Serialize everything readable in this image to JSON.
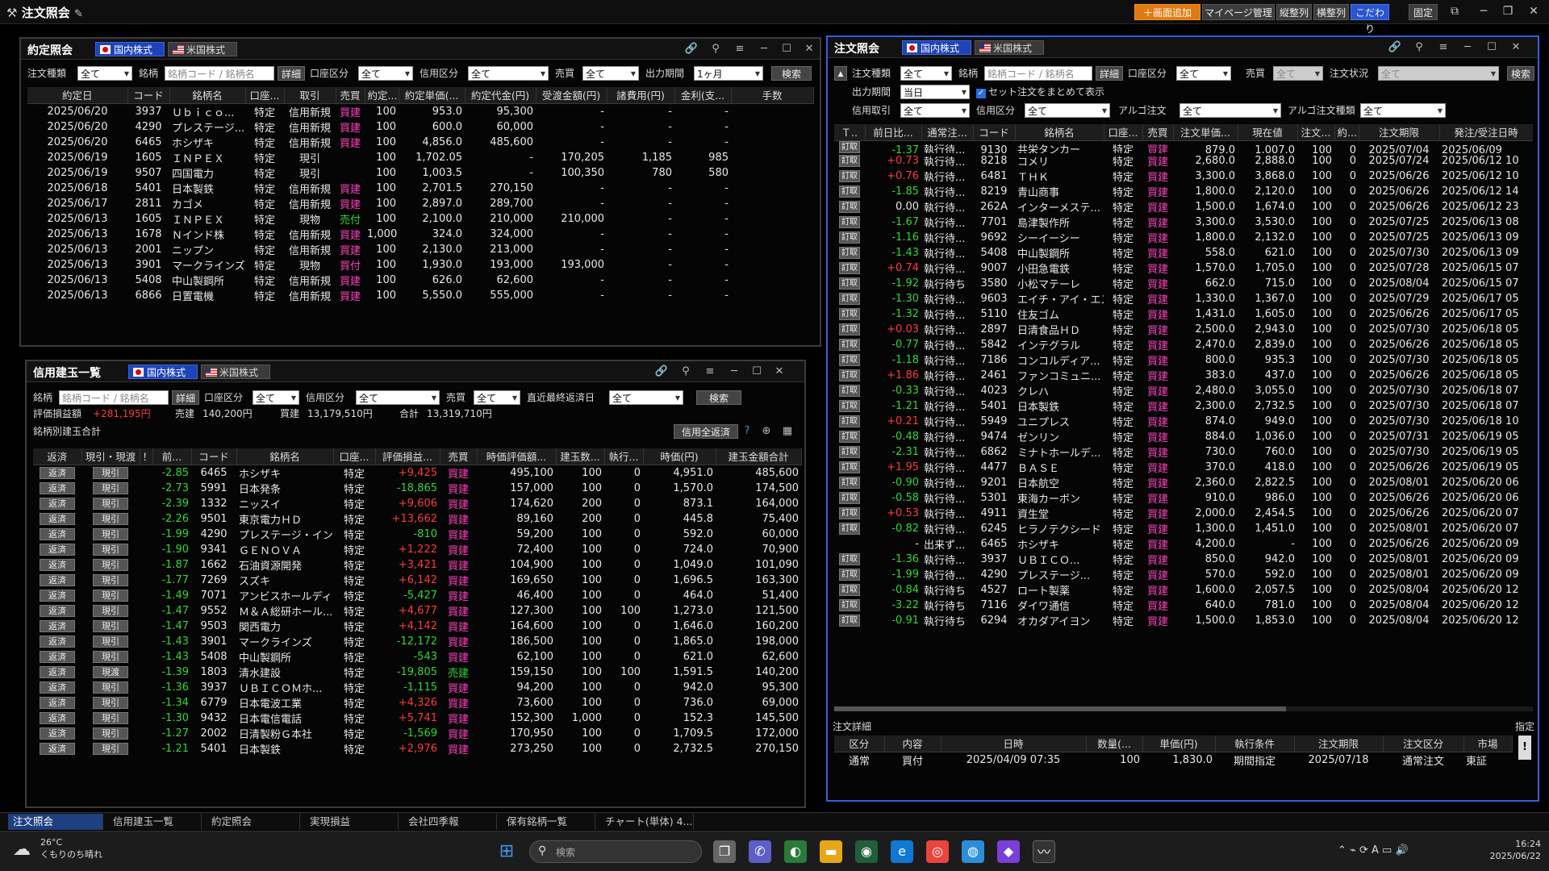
{
  "app": {
    "title": "注文照会",
    "buttons": [
      "＋画面追加",
      "マイページ管理",
      "縦整列",
      "横整列",
      "こだわり",
      "固定"
    ]
  },
  "tabs_market": {
    "domestic": "国内株式",
    "us": "米国株式"
  },
  "yakutei": {
    "title": "約定照会",
    "filters": {
      "order_type_label": "注文種類",
      "order_type": "全て",
      "stock_label": "銘柄",
      "stock_placeholder": "銘柄コード / 銘柄名",
      "detail": "詳細",
      "account_label": "口座区分",
      "account": "全て",
      "credit_label": "信用区分",
      "credit": "全て",
      "side_label": "売買",
      "side": "全て",
      "period_label": "出力期間",
      "period": "1ヶ月",
      "search": "検索"
    },
    "columns": [
      "約定日",
      "コード",
      "銘柄名",
      "口座...",
      "取引",
      "売買",
      "約定...",
      "約定単価(...",
      "約定代金(円)",
      "受渡金額(円)",
      "諸費用(円)",
      "金利(支...",
      "手数"
    ],
    "rows": [
      [
        "2025/06/20",
        "3937",
        "Ｕｂｉｃｏ...",
        "特定",
        "信用新規",
        "買建",
        "100",
        "953.0",
        "95,300",
        "-",
        "-",
        "-"
      ],
      [
        "2025/06/20",
        "4290",
        "プレステージ...",
        "特定",
        "信用新規",
        "買建",
        "100",
        "600.0",
        "60,000",
        "-",
        "-",
        "-"
      ],
      [
        "2025/06/20",
        "6465",
        "ホシザキ",
        "特定",
        "信用新規",
        "買建",
        "100",
        "4,856.0",
        "485,600",
        "-",
        "-",
        "-"
      ],
      [
        "2025/06/19",
        "1605",
        "ＩＮＰＥＸ",
        "特定",
        "現引",
        "",
        "100",
        "1,702.05",
        "-",
        "170,205",
        "1,185",
        "985"
      ],
      [
        "2025/06/19",
        "9507",
        "四国電力",
        "特定",
        "現引",
        "",
        "100",
        "1,003.5",
        "-",
        "100,350",
        "780",
        "580"
      ],
      [
        "2025/06/18",
        "5401",
        "日本製鉄",
        "特定",
        "信用新規",
        "買建",
        "100",
        "2,701.5",
        "270,150",
        "-",
        "-",
        "-"
      ],
      [
        "2025/06/17",
        "2811",
        "カゴメ",
        "特定",
        "信用新規",
        "買建",
        "100",
        "2,897.0",
        "289,700",
        "-",
        "-",
        "-"
      ],
      [
        "2025/06/13",
        "1605",
        "ＩＮＰＥＸ",
        "特定",
        "現物",
        "売付",
        "100",
        "2,100.0",
        "210,000",
        "210,000",
        "-",
        "-"
      ],
      [
        "2025/06/13",
        "1678",
        "Ｎインド株",
        "特定",
        "信用新規",
        "買建",
        "1,000",
        "324.0",
        "324,000",
        "-",
        "-",
        "-"
      ],
      [
        "2025/06/13",
        "2001",
        "ニップン",
        "特定",
        "信用新規",
        "買建",
        "100",
        "2,130.0",
        "213,000",
        "-",
        "-",
        "-"
      ],
      [
        "2025/06/13",
        "3901",
        "マークラインズ",
        "特定",
        "現物",
        "買付",
        "100",
        "1,930.0",
        "193,000",
        "193,000",
        "-",
        "-"
      ],
      [
        "2025/06/13",
        "5408",
        "中山製鋼所",
        "特定",
        "信用新規",
        "買建",
        "100",
        "626.0",
        "62,600",
        "-",
        "-",
        "-"
      ],
      [
        "2025/06/13",
        "6866",
        "日置電機",
        "特定",
        "信用新規",
        "買建",
        "100",
        "5,550.0",
        "555,000",
        "-",
        "-",
        "-"
      ]
    ]
  },
  "shinyo": {
    "title": "信用建玉一覧",
    "filters": {
      "stock_label": "銘柄",
      "stock_placeholder": "銘柄コード / 銘柄名",
      "detail": "詳細",
      "account_label": "口座区分",
      "account": "全て",
      "credit_label": "信用区分",
      "credit": "全て",
      "side_label": "売買",
      "side": "全て",
      "last_label": "直近最終返済日",
      "last": "全て",
      "search": "検索"
    },
    "summary": {
      "pl_label": "評価損益額",
      "pl": "+281,195円",
      "sell_label": "売建",
      "sell": "140,200円",
      "buy_label": "買建",
      "buy": "13,179,510円",
      "total_label": "合計",
      "total": "13,319,710円",
      "group_label": "銘柄別建玉合計",
      "bulk_button": "信用全返済"
    },
    "columns": [
      "返済",
      "現引・現渡",
      "！",
      "前...",
      "コード",
      "銘柄名",
      "口座...",
      "評価損益...",
      "売買",
      "時価評価額...",
      "建玉数...",
      "執行...",
      "時価(円)",
      "建玉金額合計"
    ],
    "rows": [
      [
        "返済",
        "現引",
        "-2.85",
        "6465",
        "ホシザキ",
        "特定",
        "+9,425",
        "買建",
        "495,100",
        "100",
        "0",
        "4,951.0",
        "485,600"
      ],
      [
        "返済",
        "現引",
        "-2.73",
        "5991",
        "日本発条",
        "特定",
        "-18,865",
        "買建",
        "157,000",
        "100",
        "0",
        "1,570.0",
        "174,500"
      ],
      [
        "返済",
        "現引",
        "-2.39",
        "1332",
        "ニッスイ",
        "特定",
        "+9,606",
        "買建",
        "174,620",
        "200",
        "0",
        "873.1",
        "164,000"
      ],
      [
        "返済",
        "現引",
        "-2.26",
        "9501",
        "東京電力ＨＤ",
        "特定",
        "+13,662",
        "買建",
        "89,160",
        "200",
        "0",
        "445.8",
        "75,400"
      ],
      [
        "返済",
        "現引",
        "-1.99",
        "4290",
        "プレステージ・インター",
        "特定",
        "-810",
        "買建",
        "59,200",
        "100",
        "0",
        "592.0",
        "60,000"
      ],
      [
        "返済",
        "現引",
        "-1.90",
        "9341",
        "ＧＥＮＯＶＡ",
        "特定",
        "+1,222",
        "買建",
        "72,400",
        "100",
        "0",
        "724.0",
        "70,900"
      ],
      [
        "返済",
        "現引",
        "-1.87",
        "1662",
        "石油資源開発",
        "特定",
        "+3,421",
        "買建",
        "104,900",
        "100",
        "0",
        "1,049.0",
        "101,090"
      ],
      [
        "返済",
        "現引",
        "-1.77",
        "7269",
        "スズキ",
        "特定",
        "+6,142",
        "買建",
        "169,650",
        "100",
        "0",
        "1,696.5",
        "163,300"
      ],
      [
        "返済",
        "現引",
        "-1.49",
        "7071",
        "アンビスホールディ...",
        "特定",
        "-5,427",
        "買建",
        "46,400",
        "100",
        "0",
        "464.0",
        "51,400"
      ],
      [
        "返済",
        "現引",
        "-1.47",
        "9552",
        "Ｍ＆Ａ総研ホール...",
        "特定",
        "+4,677",
        "買建",
        "127,300",
        "100",
        "100",
        "1,273.0",
        "121,500"
      ],
      [
        "返済",
        "現引",
        "-1.47",
        "9503",
        "関西電力",
        "特定",
        "+4,142",
        "買建",
        "164,600",
        "100",
        "0",
        "1,646.0",
        "160,200"
      ],
      [
        "返済",
        "現引",
        "-1.43",
        "3901",
        "マークラインズ",
        "特定",
        "-12,172",
        "買建",
        "186,500",
        "100",
        "0",
        "1,865.0",
        "198,000"
      ],
      [
        "返済",
        "現引",
        "-1.43",
        "5408",
        "中山製鋼所",
        "特定",
        "-543",
        "買建",
        "62,100",
        "100",
        "0",
        "621.0",
        "62,600"
      ],
      [
        "返済",
        "現渡",
        "-1.39",
        "1803",
        "清水建設",
        "特定",
        "-19,805",
        "売建",
        "159,150",
        "100",
        "100",
        "1,591.5",
        "140,200"
      ],
      [
        "返済",
        "現引",
        "-1.36",
        "3937",
        "ＵＢＩＣＯＭホ...",
        "特定",
        "-1,115",
        "買建",
        "94,200",
        "100",
        "0",
        "942.0",
        "95,300"
      ],
      [
        "返済",
        "現引",
        "-1.34",
        "6779",
        "日本電波工業",
        "特定",
        "+4,326",
        "買建",
        "73,600",
        "100",
        "0",
        "736.0",
        "69,000"
      ],
      [
        "返済",
        "現引",
        "-1.30",
        "9432",
        "日本電信電話",
        "特定",
        "+5,741",
        "買建",
        "152,300",
        "1,000",
        "0",
        "152.3",
        "145,500"
      ],
      [
        "返済",
        "現引",
        "-1.27",
        "2002",
        "日清製粉Ｇ本社",
        "特定",
        "-1,569",
        "買建",
        "170,950",
        "100",
        "0",
        "1,709.5",
        "172,000"
      ],
      [
        "返済",
        "現引",
        "-1.21",
        "5401",
        "日本製鉄",
        "特定",
        "+2,976",
        "買建",
        "273,250",
        "100",
        "0",
        "2,732.5",
        "270,150"
      ]
    ]
  },
  "chumon": {
    "title": "注文照会",
    "filters": {
      "order_type_label": "注文種類",
      "order_type": "全て",
      "stock_label": "銘柄",
      "stock_placeholder": "銘柄コード / 銘柄名",
      "detail": "詳細",
      "account_label": "口座区分",
      "account": "全て",
      "side_label": "売買",
      "side": "全て",
      "status_label": "注文状況",
      "status": "全て",
      "period_label": "出力期間",
      "period": "当日",
      "set_order_label": "セット注文をまとめて表示",
      "credit_label": "信用取引",
      "credit": "全て",
      "credit_class_label": "信用区分",
      "credit_class": "全て",
      "algo_label": "アルゴ注文",
      "algo": "全て",
      "algo_type_label": "アルゴ注文種類",
      "algo_type": "全て",
      "search": "検索"
    },
    "columns": [
      "Ｔ..",
      "前日比...",
      "通常注...",
      "コード",
      "銘柄名",
      "口座...",
      "売買",
      "注文単価...",
      "現在値",
      "注文...",
      "約...",
      "注文期限",
      "発注/受注日時"
    ],
    "partial_row": [
      "訂取",
      "-1.37",
      "執行待...",
      "9130",
      "共栄タンカー",
      "特定",
      "買建",
      "879.0",
      "1,007.0",
      "100",
      "0",
      "2025/07/04",
      "2025/06/09"
    ],
    "rows": [
      [
        "訂取",
        "+0.73",
        "執行待...",
        "8218",
        "コメリ",
        "特定",
        "買建",
        "2,680.0",
        "2,888.0",
        "100",
        "0",
        "2025/07/24",
        "2025/06/12 10"
      ],
      [
        "訂取",
        "+0.76",
        "執行待...",
        "6481",
        "ＴＨＫ",
        "特定",
        "買建",
        "3,300.0",
        "3,868.0",
        "100",
        "0",
        "2025/06/26",
        "2025/06/12 10"
      ],
      [
        "訂取",
        "-1.85",
        "執行待...",
        "8219",
        "青山商事",
        "特定",
        "買建",
        "1,800.0",
        "2,120.0",
        "100",
        "0",
        "2025/06/26",
        "2025/06/12 14"
      ],
      [
        "訂取",
        "0.00",
        "執行待...",
        "262A",
        "インターメステ...",
        "特定",
        "買建",
        "1,500.0",
        "1,674.0",
        "100",
        "0",
        "2025/06/26",
        "2025/06/12 23"
      ],
      [
        "訂取",
        "-1.67",
        "執行待...",
        "7701",
        "島津製作所",
        "特定",
        "買建",
        "3,300.0",
        "3,530.0",
        "100",
        "0",
        "2025/07/25",
        "2025/06/13 08"
      ],
      [
        "訂取",
        "-1.16",
        "執行待...",
        "9692",
        "シーイーシー",
        "特定",
        "買建",
        "1,800.0",
        "2,132.0",
        "100",
        "0",
        "2025/07/25",
        "2025/06/13 09"
      ],
      [
        "訂取",
        "-1.43",
        "執行待...",
        "5408",
        "中山製鋼所",
        "特定",
        "買建",
        "558.0",
        "621.0",
        "100",
        "0",
        "2025/07/30",
        "2025/06/13 09"
      ],
      [
        "訂取",
        "+0.74",
        "執行待...",
        "9007",
        "小田急電鉄",
        "特定",
        "買建",
        "1,570.0",
        "1,705.0",
        "100",
        "0",
        "2025/07/28",
        "2025/06/15 07"
      ],
      [
        "訂取",
        "-1.92",
        "執行待ち",
        "3580",
        "小松マテーレ",
        "特定",
        "買建",
        "662.0",
        "715.0",
        "100",
        "0",
        "2025/08/04",
        "2025/06/15 07"
      ],
      [
        "訂取",
        "-1.30",
        "執行待...",
        "9603",
        "エイチ・アイ・エス",
        "特定",
        "買建",
        "1,330.0",
        "1,367.0",
        "100",
        "0",
        "2025/07/29",
        "2025/06/17 05"
      ],
      [
        "訂取",
        "-1.32",
        "執行待...",
        "5110",
        "住友ゴム",
        "特定",
        "買建",
        "1,431.0",
        "1,605.0",
        "100",
        "0",
        "2025/06/26",
        "2025/06/17 05"
      ],
      [
        "訂取",
        "+0.03",
        "執行待...",
        "2897",
        "日清食品ＨＤ",
        "特定",
        "買建",
        "2,500.0",
        "2,943.0",
        "100",
        "0",
        "2025/07/30",
        "2025/06/18 05"
      ],
      [
        "訂取",
        "-0.77",
        "執行待...",
        "5842",
        "インテグラル",
        "特定",
        "買建",
        "2,470.0",
        "2,839.0",
        "100",
        "0",
        "2025/06/26",
        "2025/06/18 05"
      ],
      [
        "訂取",
        "-1.18",
        "執行待...",
        "7186",
        "コンコルディア...",
        "特定",
        "買建",
        "800.0",
        "935.3",
        "100",
        "0",
        "2025/07/30",
        "2025/06/18 05"
      ],
      [
        "訂取",
        "+1.86",
        "執行待...",
        "2461",
        "ファンコミュニ...",
        "特定",
        "買建",
        "383.0",
        "437.0",
        "100",
        "0",
        "2025/06/26",
        "2025/06/18 05"
      ],
      [
        "訂取",
        "-0.33",
        "執行待...",
        "4023",
        "クレハ",
        "特定",
        "買建",
        "2,480.0",
        "3,055.0",
        "100",
        "0",
        "2025/07/30",
        "2025/06/18 07"
      ],
      [
        "訂取",
        "-1.21",
        "執行待...",
        "5401",
        "日本製鉄",
        "特定",
        "買建",
        "2,300.0",
        "2,732.5",
        "100",
        "0",
        "2025/07/30",
        "2025/06/18 07"
      ],
      [
        "訂取",
        "+0.21",
        "執行待...",
        "5949",
        "ユニプレス",
        "特定",
        "買建",
        "874.0",
        "949.0",
        "100",
        "0",
        "2025/07/30",
        "2025/06/18 10"
      ],
      [
        "訂取",
        "-0.48",
        "執行待...",
        "9474",
        "ゼンリン",
        "特定",
        "買建",
        "884.0",
        "1,036.0",
        "100",
        "0",
        "2025/07/31",
        "2025/06/19 05"
      ],
      [
        "訂取",
        "-2.31",
        "執行待...",
        "6862",
        "ミナトホールデ...",
        "特定",
        "買建",
        "730.0",
        "760.0",
        "100",
        "0",
        "2025/07/30",
        "2025/06/19 05"
      ],
      [
        "訂取",
        "+1.95",
        "執行待...",
        "4477",
        "ＢＡＳＥ",
        "特定",
        "買建",
        "370.0",
        "418.0",
        "100",
        "0",
        "2025/06/26",
        "2025/06/19 05"
      ],
      [
        "訂取",
        "-0.90",
        "執行待...",
        "9201",
        "日本航空",
        "特定",
        "買建",
        "2,360.0",
        "2,822.5",
        "100",
        "0",
        "2025/08/01",
        "2025/06/20 06"
      ],
      [
        "訂取",
        "-0.58",
        "執行待...",
        "5301",
        "東海カーボン",
        "特定",
        "買建",
        "910.0",
        "986.0",
        "100",
        "0",
        "2025/06/26",
        "2025/06/20 06"
      ],
      [
        "訂取",
        "+0.53",
        "執行待...",
        "4911",
        "資生堂",
        "特定",
        "買建",
        "2,000.0",
        "2,454.5",
        "100",
        "0",
        "2025/06/26",
        "2025/06/20 07"
      ],
      [
        "訂取",
        "-0.82",
        "執行待...",
        "6245",
        "ヒラノテクシード",
        "特定",
        "買建",
        "1,300.0",
        "1,451.0",
        "100",
        "0",
        "2025/08/01",
        "2025/06/20 07"
      ],
      [
        "",
        "-",
        "出来ず...",
        "6465",
        "ホシザキ",
        "特定",
        "買建",
        "4,200.0",
        "-",
        "100",
        "0",
        "2025/06/26",
        "2025/06/20 09"
      ],
      [
        "訂取",
        "-1.36",
        "執行待...",
        "3937",
        "ＵＢＩＣＯ...",
        "特定",
        "買建",
        "850.0",
        "942.0",
        "100",
        "0",
        "2025/08/01",
        "2025/06/20 09"
      ],
      [
        "訂取",
        "-1.99",
        "執行待...",
        "4290",
        "プレステージ...",
        "特定",
        "買建",
        "570.0",
        "592.0",
        "100",
        "0",
        "2025/08/01",
        "2025/06/20 09"
      ],
      [
        "訂取",
        "-0.84",
        "執行待ち",
        "4527",
        "ロート製薬",
        "特定",
        "買建",
        "1,600.0",
        "2,057.5",
        "100",
        "0",
        "2025/08/04",
        "2025/06/20 12"
      ],
      [
        "訂取",
        "-3.22",
        "執行待ち",
        "7116",
        "ダイワ通信",
        "特定",
        "買建",
        "640.0",
        "781.0",
        "100",
        "0",
        "2025/08/04",
        "2025/06/20 12"
      ],
      [
        "訂取",
        "-0.91",
        "執行待ち",
        "6294",
        "オカダアイヨン",
        "特定",
        "買建",
        "1,500.0",
        "1,853.0",
        "100",
        "0",
        "2025/08/04",
        "2025/06/20 12"
      ]
    ],
    "detail": {
      "title": "注文詳細",
      "side_label": "指定",
      "columns": [
        "区分",
        "内容",
        "日時",
        "数量(...",
        "単価(円)",
        "執行条件",
        "注文期限",
        "注文区分",
        "市場"
      ],
      "row": [
        "通常",
        "買付",
        "2025/04/09 07:35",
        "100",
        "1,830.0",
        "期間指定",
        "2025/07/18",
        "通常注文",
        "東証"
      ]
    }
  },
  "bottom_tabs": [
    "注文照会",
    "信用建玉一覧",
    "約定照会",
    "実現損益",
    "会社四季報",
    "保有銘柄一覧",
    "チャート(単体) 4..."
  ],
  "taskbar": {
    "weather_temp": "26°C",
    "weather_text": "くもりのち晴れ",
    "search_placeholder": "検索",
    "time": "16:24",
    "date": "2025/06/22"
  }
}
